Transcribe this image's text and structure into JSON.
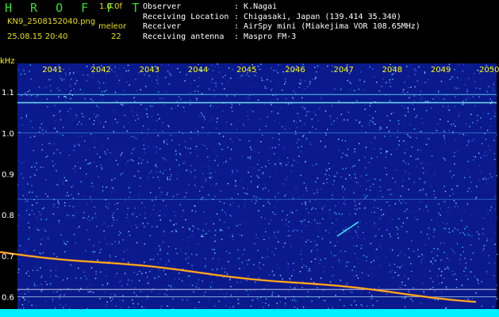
{
  "app": {
    "logo": "H R O F F T",
    "version": "1.0.0f",
    "filename": "KN9_2508152040.png",
    "datetime": "25.08.15 20:40",
    "meteor_label": "meleor",
    "meteor_count": "22"
  },
  "station": [
    {
      "key": "Observer",
      "value": "K.Nagai"
    },
    {
      "key": "Receiving Location",
      "value": "Chigasaki, Japan (139.414 35.340)"
    },
    {
      "key": "Receiver",
      "value": "AirSpy mini (Miakejima VOR 108.65MHz)"
    },
    {
      "key": "Receiving antenna",
      "value": "Maspro FM-3"
    }
  ],
  "chart_data": {
    "type": "heatmap",
    "yunit": "kHz",
    "xticks": [
      "2041",
      "2042",
      "2043",
      "2044",
      "2045",
      "2046",
      "2047",
      "2048",
      "2049",
      "2050"
    ],
    "yticks": [
      "1.1",
      "1.0",
      "0.9",
      "0.8",
      "0.7",
      "0.6"
    ],
    "ylim": [
      0.57,
      1.17
    ],
    "colors": {
      "background": "#0a1a8c",
      "noise": "#3b5bd6",
      "signal": "#ffd400",
      "bottom_bar": "#00f0ff",
      "axis_text": "#ffff00",
      "tick_text": "#ffffff"
    }
  }
}
